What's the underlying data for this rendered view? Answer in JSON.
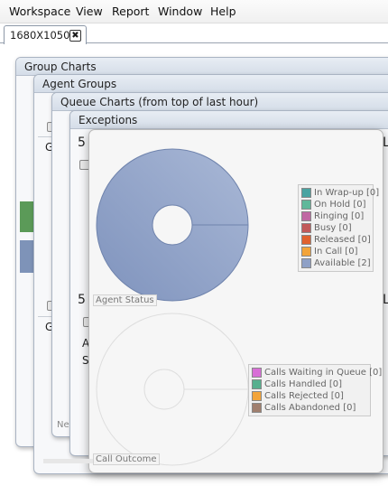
{
  "menu": {
    "items": [
      "Workspace",
      "View",
      "Report",
      "Window",
      "Help"
    ]
  },
  "tab": {
    "label": "1680X1050",
    "close_glyph": "✖"
  },
  "panels": {
    "group_charts": "Group Charts",
    "agent_groups": "Agent Groups",
    "queue_charts": "Queue Charts (from top of last hour)",
    "exceptions": "Exceptions"
  },
  "fragments": {
    "five": "5",
    "five_b": "5",
    "g1": "G",
    "g2": "G",
    "l1": "L",
    "l2": "L",
    "a": "A",
    "s": "S",
    "ne": "Ne"
  },
  "popup": {
    "agent_status": {
      "label": "Agent Status",
      "legend": [
        {
          "text": "In Wrap-up [0]",
          "color": "#4aa3a1"
        },
        {
          "text": "On Hold [0]",
          "color": "#5fb89a"
        },
        {
          "text": "Ringing [0]",
          "color": "#c067a3"
        },
        {
          "text": "Busy [0]",
          "color": "#c25a5a"
        },
        {
          "text": "Released [0]",
          "color": "#e0622f"
        },
        {
          "text": "In Call [0]",
          "color": "#f2a43a"
        },
        {
          "text": "Available [2]",
          "color": "#8ea0c6"
        }
      ]
    },
    "call_outcome": {
      "label": "Call Outcome",
      "legend": [
        {
          "text": "Calls Waiting in Queue [0]",
          "color": "#d86fd6"
        },
        {
          "text": "Calls Handled [0]",
          "color": "#57b08f"
        },
        {
          "text": "Calls Rejected [0]",
          "color": "#f2a43a"
        },
        {
          "text": "Calls Abandoned [0]",
          "color": "#a07f6e"
        }
      ]
    }
  }
}
